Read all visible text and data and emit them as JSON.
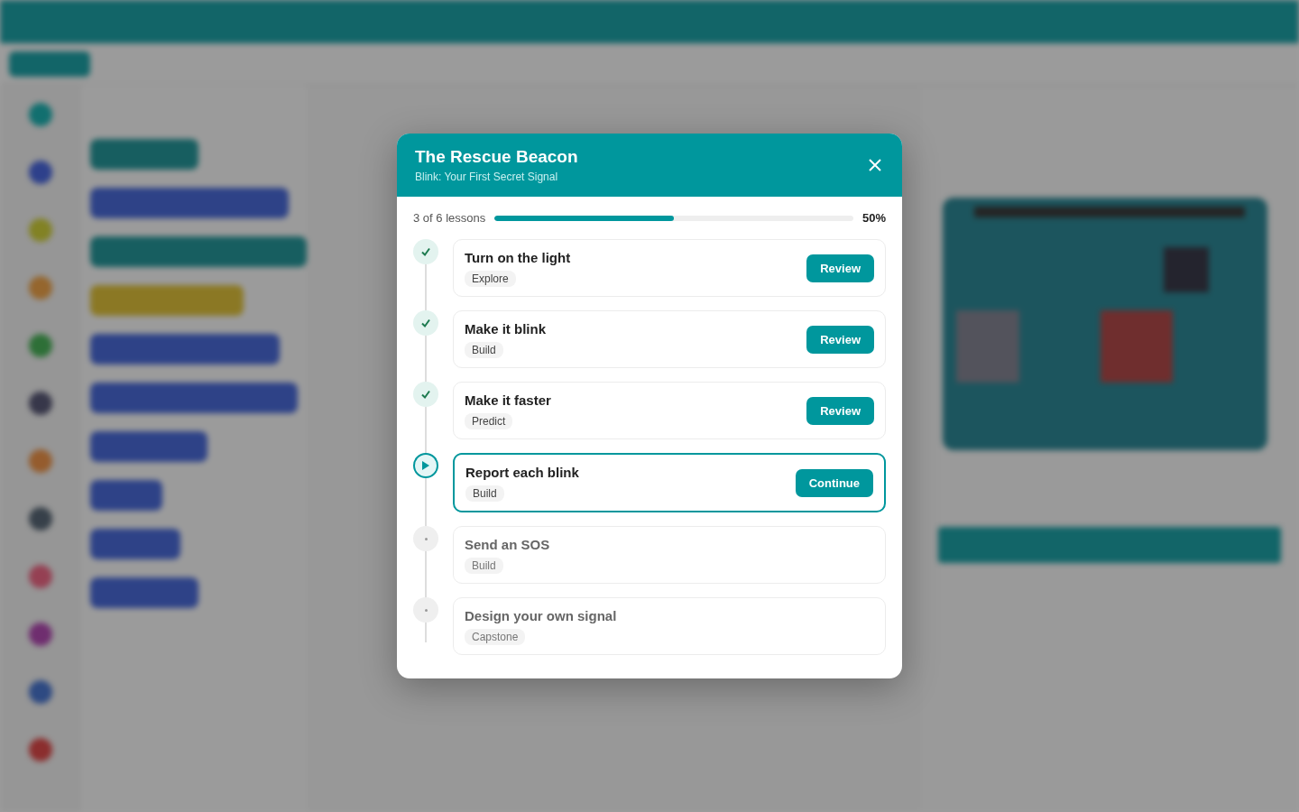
{
  "dialog": {
    "title": "The Rescue Beacon",
    "subtitle": "Blink: Your First Secret Signal"
  },
  "progress": {
    "label": "3 of 6 lessons",
    "level": 0.5,
    "percent": "50%"
  },
  "lessons": [
    {
      "kind": "done",
      "title": "Turn on the light",
      "tag": "Explore",
      "action": "Review"
    },
    {
      "kind": "done",
      "title": "Make it blink",
      "tag": "Build",
      "action": "Review"
    },
    {
      "kind": "done",
      "title": "Make it faster",
      "tag": "Predict",
      "action": "Review"
    },
    {
      "kind": "current",
      "title": "Report each blink",
      "tag": "Build",
      "action": "Continue"
    },
    {
      "kind": "locked",
      "title": "Send an SOS",
      "tag": "Build"
    },
    {
      "kind": "locked",
      "title": "Design your own signal",
      "tag": "Capstone"
    }
  ]
}
